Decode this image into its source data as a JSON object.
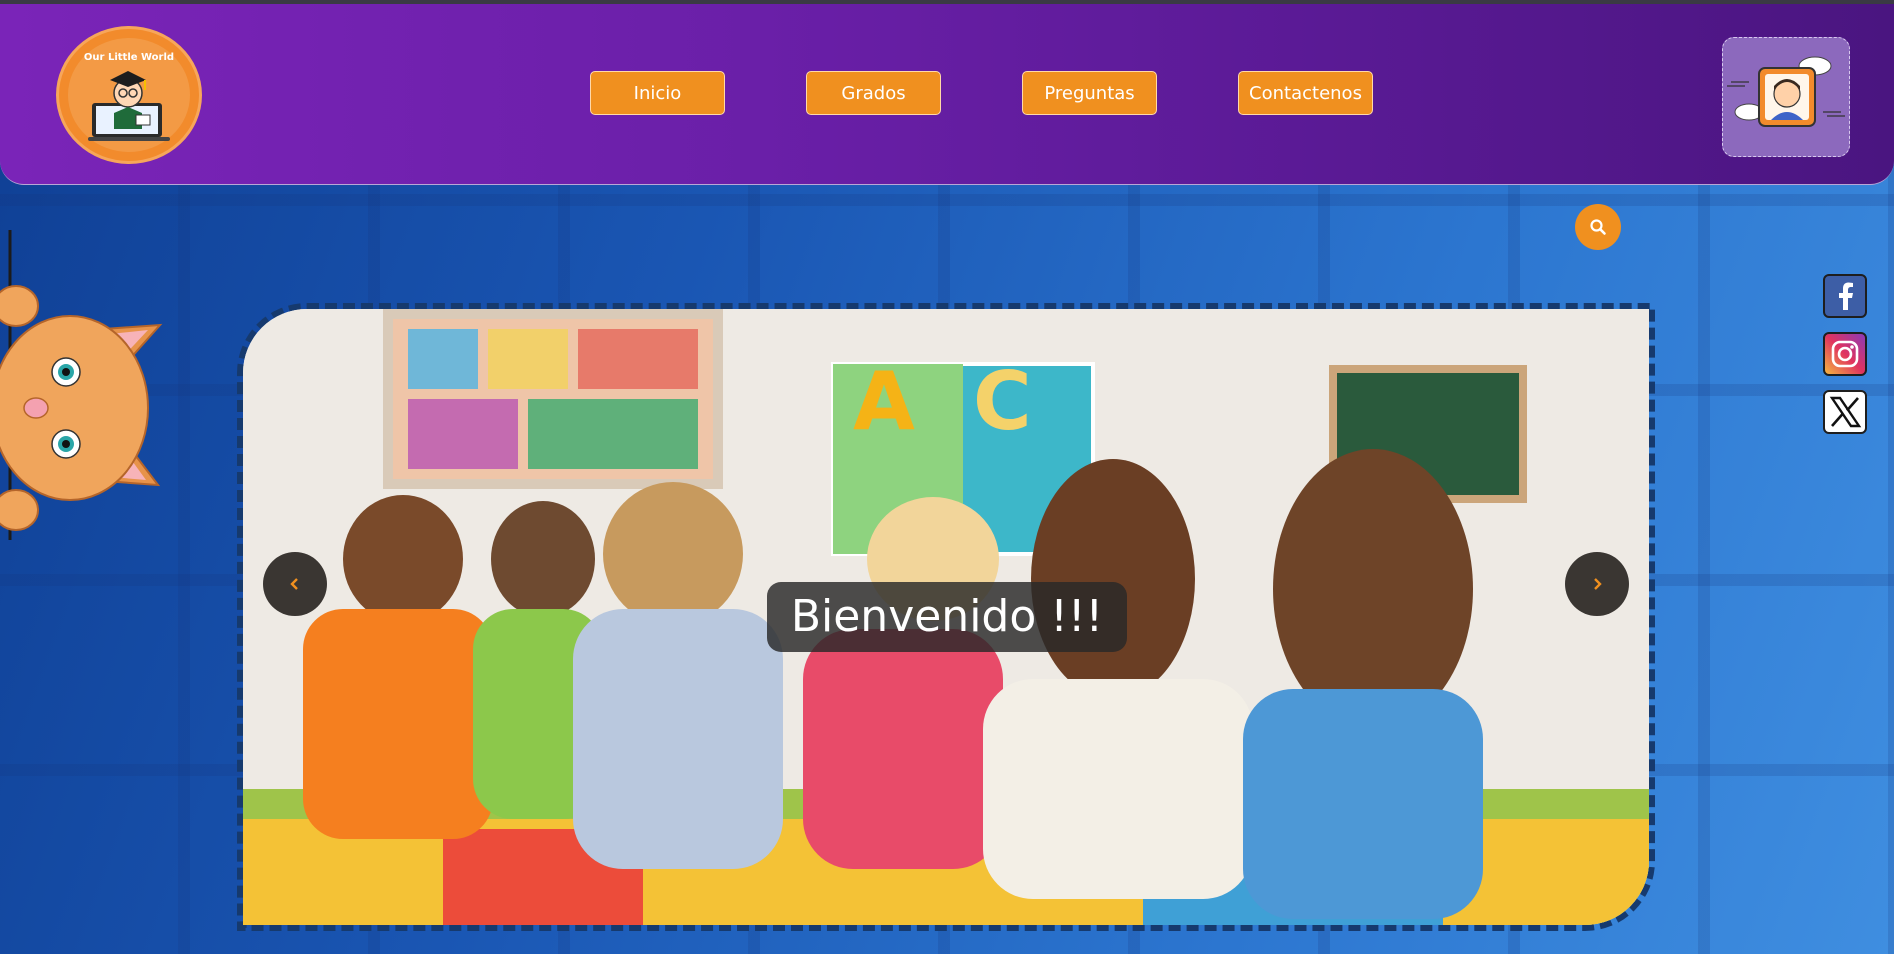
{
  "header": {
    "logo_text": "Our Little World",
    "nav": [
      {
        "label": "Inicio"
      },
      {
        "label": "Grados"
      },
      {
        "label": "Preguntas"
      },
      {
        "label": "Contactenos"
      }
    ]
  },
  "icons": {
    "search": "search-icon",
    "facebook": "facebook-icon",
    "instagram": "instagram-icon",
    "x": "x-icon",
    "prev": "chevron-left-icon",
    "next": "chevron-right-icon"
  },
  "slider": {
    "caption": "Bienvenido !!!"
  },
  "colors": {
    "header": "#6a1fa8",
    "accent": "#f0901f",
    "background": "#1a56b3",
    "slider_border": "#163a6e"
  }
}
